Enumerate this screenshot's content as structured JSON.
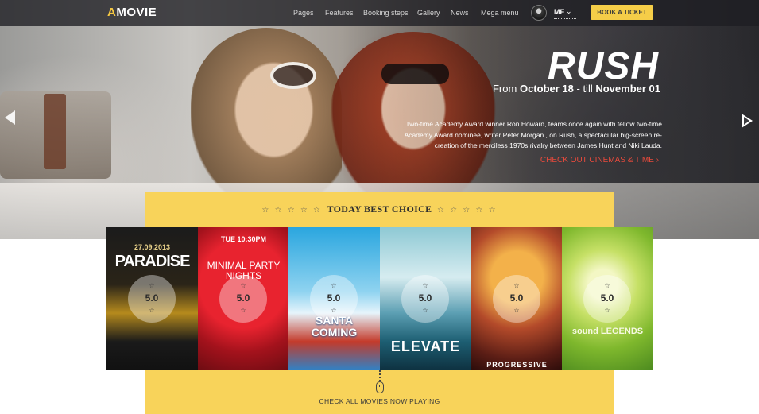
{
  "nav": {
    "logo_prefix": "A",
    "logo_text": "MOVIE",
    "items": [
      "Pages",
      "Features",
      "Booking steps",
      "Gallery",
      "News",
      "Mega menu"
    ],
    "user_label": "ME",
    "book_button": "BOOK A TICKET"
  },
  "slide": {
    "title": "RUSH",
    "date_prefix": "From",
    "date_from": "October 18",
    "date_sep": "- till",
    "date_to": "November 01",
    "description": "Two-time Academy Award winner Ron Howard, teams once again with fellow two-time Academy Award nominee, writer Peter Morgan , on Rush, a spectacular big-screen re-creation of the merciless 1970s rivalry between James Hunt and Niki Lauda.",
    "cta": "CHECK OUT CINEMAS & TIME"
  },
  "best_choice": {
    "title": "TODAY BEST CHOICE",
    "stars": "☆ ☆ ☆ ☆ ☆",
    "posters": [
      {
        "name": "PARADISE",
        "rating": "5.0"
      },
      {
        "name": "MINIMAL PARTY NIGHTS",
        "rating": "5.0"
      },
      {
        "name": "SANTA COMING",
        "rating": "5.0"
      },
      {
        "name": "ELEVATE",
        "rating": "5.0"
      },
      {
        "name": "PROGRESSIVE",
        "rating": "5.0"
      },
      {
        "name": "sound LEGENDS",
        "rating": "5.0"
      }
    ],
    "check_all": "CHECK ALL MOVIES NOW PLAYING"
  },
  "colors": {
    "accent_yellow": "#f8d35a",
    "cta_red": "#e84a3c",
    "nav_bg": "#1e1e22"
  }
}
